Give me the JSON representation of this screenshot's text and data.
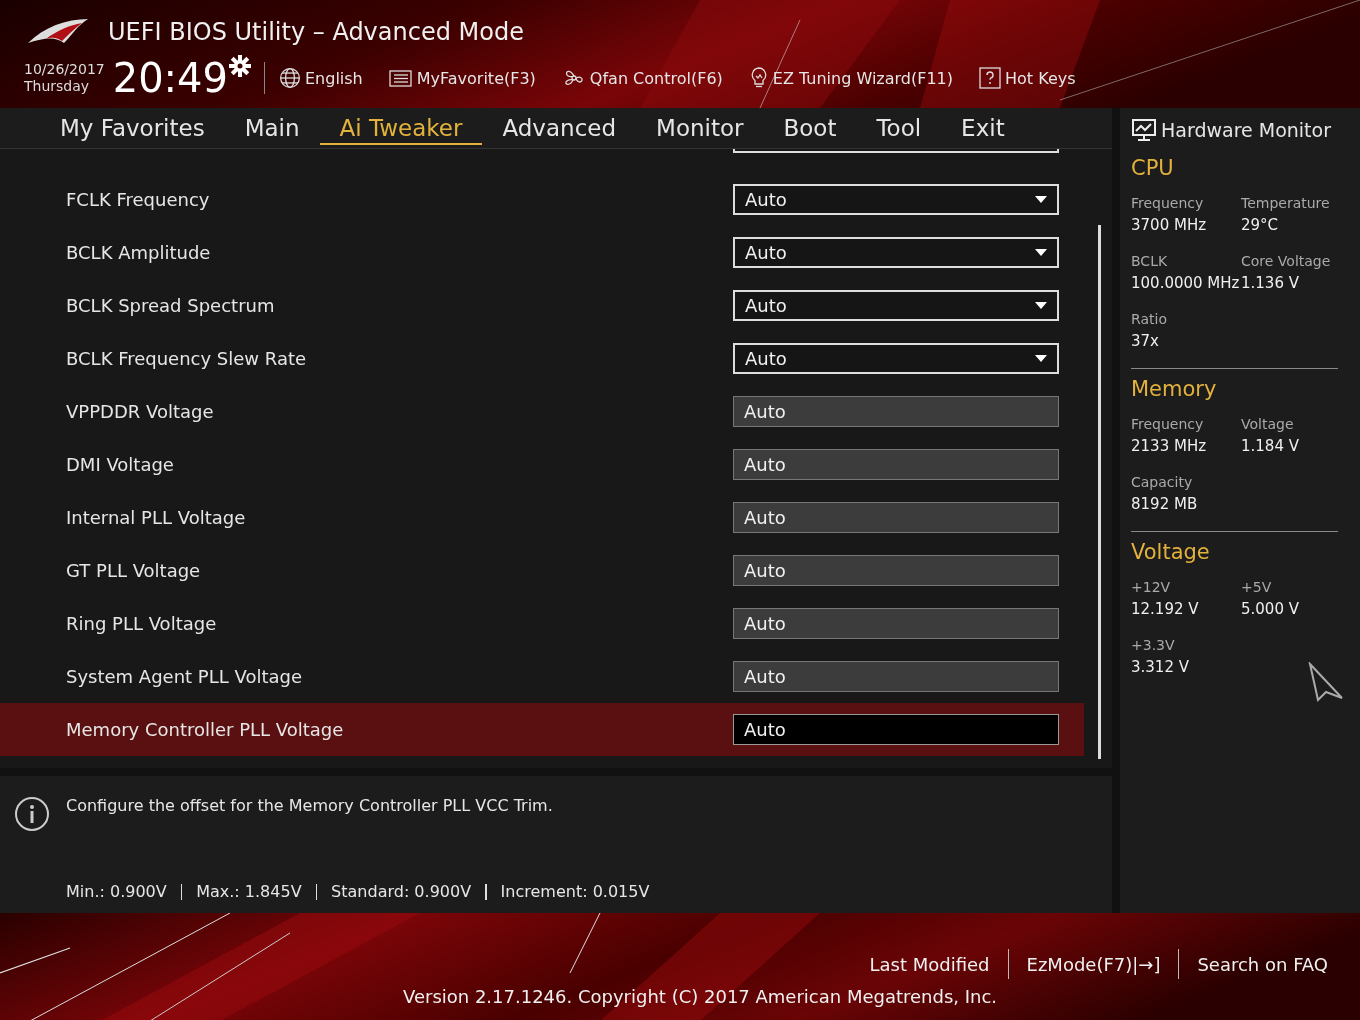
{
  "header": {
    "title": "UEFI BIOS Utility – Advanced Mode",
    "date": "10/26/2017",
    "day": "Thursday",
    "time": "20:49",
    "tools": [
      {
        "label": "English",
        "kind": "globe"
      },
      {
        "label": "MyFavorite(F3)",
        "kind": "list"
      },
      {
        "label": "Qfan Control(F6)",
        "kind": "fan"
      },
      {
        "label": "EZ Tuning Wizard(F11)",
        "kind": "bulb"
      },
      {
        "label": "Hot Keys",
        "kind": "help"
      }
    ]
  },
  "tabs": [
    {
      "label": "My Favorites",
      "selected": false
    },
    {
      "label": "Main",
      "selected": false
    },
    {
      "label": "Ai Tweaker",
      "selected": true
    },
    {
      "label": "Advanced",
      "selected": false
    },
    {
      "label": "Monitor",
      "selected": false
    },
    {
      "label": "Boot",
      "selected": false
    },
    {
      "label": "Tool",
      "selected": false
    },
    {
      "label": "Exit",
      "selected": false
    }
  ],
  "settings": [
    {
      "label": "FCLK Frequency",
      "value": "Auto",
      "kind": "dropdown",
      "selected": false
    },
    {
      "label": "BCLK Amplitude",
      "value": "Auto",
      "kind": "dropdown",
      "selected": false
    },
    {
      "label": "BCLK Spread Spectrum",
      "value": "Auto",
      "kind": "dropdown",
      "selected": false
    },
    {
      "label": "BCLK Frequency Slew Rate",
      "value": "Auto",
      "kind": "dropdown",
      "selected": false
    },
    {
      "label": "VPPDDR Voltage",
      "value": "Auto",
      "kind": "input",
      "selected": false
    },
    {
      "label": "DMI Voltage",
      "value": "Auto",
      "kind": "input",
      "selected": false
    },
    {
      "label": "Internal PLL Voltage",
      "value": "Auto",
      "kind": "input",
      "selected": false
    },
    {
      "label": "GT PLL Voltage",
      "value": "Auto",
      "kind": "input",
      "selected": false
    },
    {
      "label": "Ring PLL Voltage",
      "value": "Auto",
      "kind": "input",
      "selected": false
    },
    {
      "label": "System Agent PLL Voltage",
      "value": "Auto",
      "kind": "input",
      "selected": false
    },
    {
      "label": "Memory Controller PLL Voltage",
      "value": "Auto",
      "kind": "input",
      "selected": true
    }
  ],
  "help": {
    "description": "Configure the offset for the Memory Controller PLL VCC Trim.",
    "limits": [
      "Min.: 0.900V",
      "Max.: 1.845V",
      "Standard: 0.900V",
      "Increment: 0.015V"
    ]
  },
  "hardware_monitor": {
    "title": "Hardware Monitor",
    "sections": [
      {
        "title": "CPU",
        "items": [
          {
            "label": "Frequency",
            "value": "3700 MHz"
          },
          {
            "label": "Temperature",
            "value": "29°C"
          },
          {
            "label": "BCLK",
            "value": "100.0000 MHz"
          },
          {
            "label": "Core Voltage",
            "value": "1.136 V"
          },
          {
            "label": "Ratio",
            "value": "37x"
          }
        ]
      },
      {
        "title": "Memory",
        "items": [
          {
            "label": "Frequency",
            "value": "2133 MHz"
          },
          {
            "label": "Voltage",
            "value": "1.184 V"
          },
          {
            "label": "Capacity",
            "value": "8192 MB"
          }
        ]
      },
      {
        "title": "Voltage",
        "items": [
          {
            "label": "+12V",
            "value": "12.192 V"
          },
          {
            "label": "+5V",
            "value": "5.000 V"
          },
          {
            "label": "+3.3V",
            "value": "3.312 V"
          }
        ]
      }
    ]
  },
  "footer": {
    "links": [
      "Last Modified",
      "EzMode(F7)|→]",
      "Search on FAQ"
    ],
    "version": "Version 2.17.1246. Copyright (C) 2017 American Megatrends, Inc."
  }
}
